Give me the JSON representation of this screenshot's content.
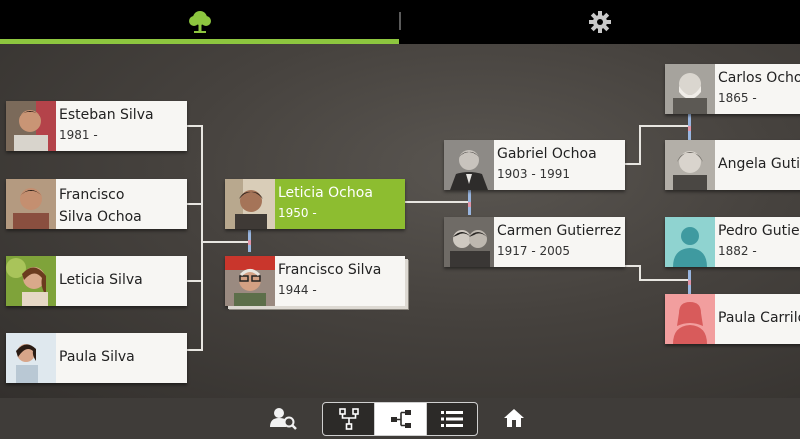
{
  "header": {
    "tabs": [
      {
        "icon": "tree-icon",
        "active": true
      },
      {
        "icon": "gear-icon",
        "active": false
      }
    ],
    "accent_color": "#8dc63f"
  },
  "people": {
    "esteban": {
      "name": "Esteban Silva",
      "dates": "1981 -"
    },
    "francisco_jr": {
      "name_line1": "Francisco",
      "name_line2": "Silva Ochoa",
      "dates": ""
    },
    "leticia_silva": {
      "name": "Leticia Silva",
      "dates": ""
    },
    "paula_silva": {
      "name": "Paula Silva",
      "dates": ""
    },
    "leticia_ochoa": {
      "name": "Leticia Ochoa",
      "dates": "1950 -"
    },
    "francisco_silva": {
      "name": "Francisco Silva",
      "dates": "1944 -"
    },
    "gabriel": {
      "name": "Gabriel Ochoa",
      "dates": "1903 - 1991"
    },
    "carmen": {
      "name": "Carmen Gutierrez",
      "dates": "1917 - 2005"
    },
    "carlos": {
      "name": "Carlos Ocho",
      "dates": "1865 -"
    },
    "angela": {
      "name": "Angela Gutie",
      "dates": ""
    },
    "pedro": {
      "name": "Pedro Gutier",
      "dates": "1882 -"
    },
    "paula_carrillo": {
      "name": "Paula Carrilo",
      "dates": ""
    }
  },
  "toolbar": {
    "buttons": [
      "person-search-icon",
      "tree-view-icon",
      "pedigree-view-icon",
      "list-view-icon",
      "home-icon"
    ],
    "active_view": "pedigree-view-icon"
  }
}
